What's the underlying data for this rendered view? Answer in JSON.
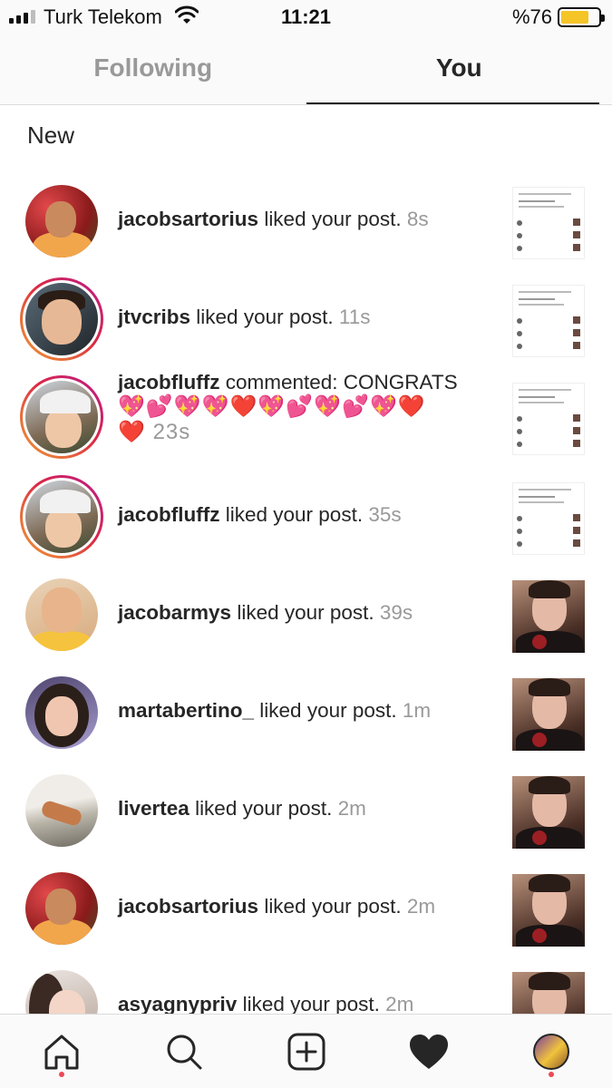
{
  "status_bar": {
    "carrier": "Turk Telekom",
    "time": "11:21",
    "battery_text": "%76",
    "battery_level": 0.76,
    "battery_color": "#f5c527"
  },
  "tabs": [
    {
      "label": "Following",
      "active": false
    },
    {
      "label": "You",
      "active": true
    }
  ],
  "section_title": "New",
  "notifications": [
    {
      "username": "jacobsartorius",
      "action": " liked your post. ",
      "time": "8s",
      "avatar": "avatar-red-flowers",
      "thumbnail": "screenshot-thumbnail"
    },
    {
      "username": "jtvcribs",
      "action": " liked your post. ",
      "time": "11s",
      "avatar": "avatar-dark-story",
      "thumbnail": "screenshot-thumbnail"
    },
    {
      "username": "jacobfluffz",
      "action": " commented: CONGRATS",
      "emoji": "💖💕💖💖❤️💖💕💖💕💖❤️",
      "emoji_last": "❤️",
      "time": "23s",
      "avatar": "avatar-cap-story",
      "thumbnail": "screenshot-thumbnail"
    },
    {
      "username": "jacobfluffz",
      "action": " liked your post. ",
      "time": "35s",
      "avatar": "avatar-cap-story",
      "thumbnail": "screenshot-thumbnail"
    },
    {
      "username": "jacobarmys",
      "action": " liked your post. ",
      "time": "39s",
      "avatar": "avatar-yellow",
      "thumbnail": "photo-thumbnail"
    },
    {
      "username": "martabertino_",
      "action": " liked your post. ",
      "time": "1m",
      "avatar": "avatar-girl",
      "thumbnail": "photo-thumbnail"
    },
    {
      "username": "livertea",
      "action": " liked your post. ",
      "time": "2m",
      "avatar": "avatar-street",
      "thumbnail": "photo-thumbnail"
    },
    {
      "username": "jacobsartorius",
      "action": " liked your post. ",
      "time": "2m",
      "avatar": "avatar-red-flowers",
      "thumbnail": "photo-thumbnail"
    },
    {
      "username": "asyagnypriv",
      "action": " liked your post. ",
      "time": "2m",
      "avatar": "avatar-pale",
      "thumbnail": "photo-thumbnail"
    }
  ],
  "tab_bar": {
    "items": [
      "home-icon",
      "search-icon",
      "add-post-icon",
      "heart-icon",
      "profile-avatar"
    ],
    "notification_dot_color": "#ed4956"
  },
  "colors": {
    "text": "#262626",
    "muted": "#999999",
    "story_ring_start": "#f09433",
    "story_ring_end": "#bc1888"
  }
}
